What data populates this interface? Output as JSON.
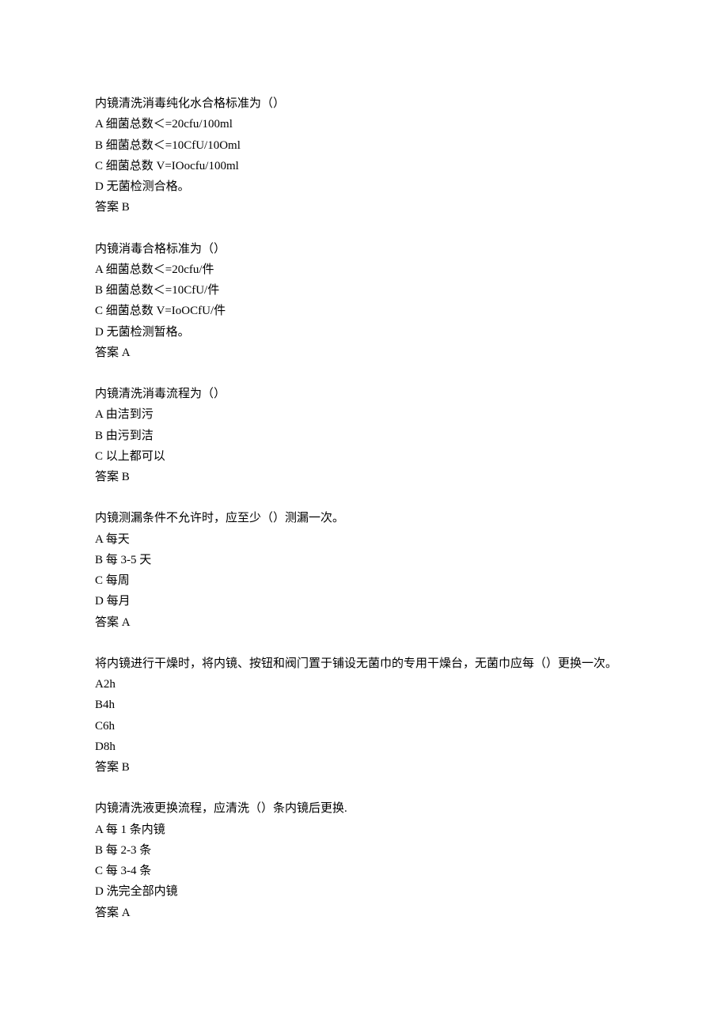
{
  "questions": [
    {
      "stem": "内镜清洗消毒纯化水合格标准为（）",
      "options": [
        "A 细菌总数＜=20cfu/100ml",
        "B 细菌总数＜=10CfU/10Oml",
        "C 细菌总数 V=IOocfu/100ml",
        "D 无菌检测合格。"
      ],
      "answer": "答案 B"
    },
    {
      "stem": "内镜消毒合格标准为（）",
      "options": [
        "A 细菌总数＜=20cfu/件",
        "B 细菌总数＜=10CfU/件",
        "C 细菌总数 V=IoOCfU/件",
        "D 无菌检测暂格。"
      ],
      "answer": "答案 A"
    },
    {
      "stem": "内镜清洗消毒流程为（）",
      "options": [
        "A 由洁到污",
        "B 由污到洁",
        "C 以上都可以"
      ],
      "answer": "答案 B"
    },
    {
      "stem": "内镜测漏条件不允许时，应至少（）测漏一次。",
      "options": [
        "A 每天",
        "B 每 3-5 天",
        "C 每周",
        "D 每月"
      ],
      "answer": "答案 A"
    },
    {
      "stem": "将内镜进行干燥时，将内镜、按钮和阀门置于铺设无菌巾的专用干燥台，无菌巾应每（）更换一次。",
      "options": [
        "A2h",
        "B4h",
        "C6h",
        "D8h"
      ],
      "answer": "答案 B"
    },
    {
      "stem": "内镜清洗液更换流程，应清洗（）条内镜后更换.",
      "options": [
        "A 每 1 条内镜",
        "B 每 2-3 条",
        "C 每 3-4 条",
        "D 洗完全部内镜"
      ],
      "answer": "答案 A"
    }
  ]
}
